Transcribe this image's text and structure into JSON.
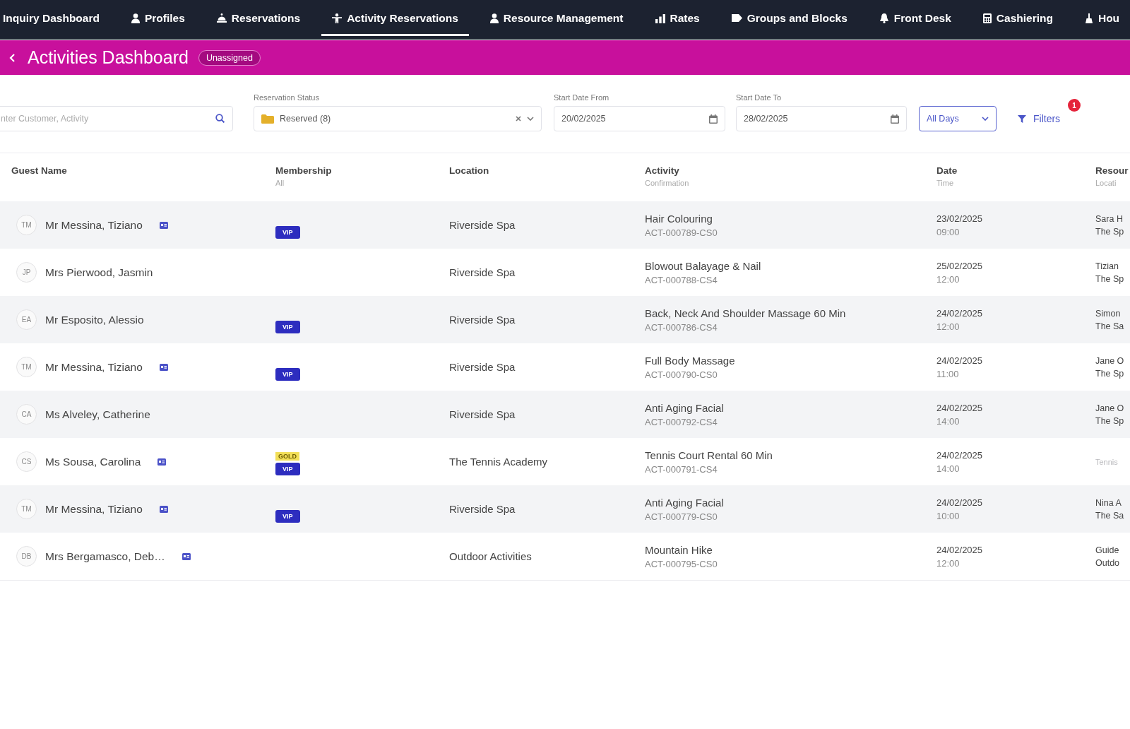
{
  "nav": {
    "items": [
      {
        "label": "Inquiry Dashboard",
        "selected": false
      },
      {
        "label": "Profiles",
        "selected": false
      },
      {
        "label": "Reservations",
        "selected": false
      },
      {
        "label": "Activity Reservations",
        "selected": true
      },
      {
        "label": "Resource Management",
        "selected": false
      },
      {
        "label": "Rates",
        "selected": false
      },
      {
        "label": "Groups and Blocks",
        "selected": false
      },
      {
        "label": "Front Desk",
        "selected": false
      },
      {
        "label": "Cashiering",
        "selected": false
      },
      {
        "label": "Hou",
        "selected": false
      }
    ]
  },
  "header": {
    "title": "Activities Dashboard",
    "badge": "Unassigned"
  },
  "filters": {
    "search": {
      "placeholder": "nter Customer, Activity"
    },
    "status": {
      "label": "Reservation Status",
      "value": "Reserved (8)"
    },
    "date_from": {
      "label": "Start Date From",
      "value": "20/02/2025"
    },
    "date_to": {
      "label": "Start Date To",
      "value": "28/02/2025"
    },
    "days": {
      "value": "All Days"
    },
    "more": {
      "label": "Filters",
      "count": "1"
    }
  },
  "table": {
    "columns": [
      {
        "title": "Guest Name"
      },
      {
        "title": "Membership",
        "subtitle": "All"
      },
      {
        "title": "Location"
      },
      {
        "title": "Activity",
        "subtitle": "Confirmation"
      },
      {
        "title": "Date",
        "subtitle": "Time"
      },
      {
        "title": "Resour",
        "subtitle": "Locati"
      }
    ],
    "rows": [
      {
        "initials": "TM",
        "guest": "Mr Messina, Tiziano",
        "note": true,
        "membership": [
          {
            "kind": "pill",
            "label": "VIP"
          }
        ],
        "location": "Riverside Spa",
        "activity": "Hair Colouring",
        "confirmation": "ACT-000789-CS0",
        "date": "23/02/2025",
        "time": "09:00",
        "resource": [
          "Sara H",
          "The Sp"
        ],
        "resource_muted": false
      },
      {
        "initials": "JP",
        "guest": "Mrs Pierwood, Jasmin",
        "note": false,
        "location": "Riverside Spa",
        "activity": "Blowout Balayage & Nail",
        "confirmation": "ACT-000788-CS4",
        "date": "25/02/2025",
        "time": "12:00",
        "resource": [
          "Tizian",
          "The Sp"
        ],
        "resource_muted": false
      },
      {
        "initials": "EA",
        "guest": "Mr Esposito, Alessio",
        "note": false,
        "membership": [
          {
            "kind": "pill",
            "label": "VIP"
          }
        ],
        "location": "Riverside Spa",
        "activity": "Back, Neck And Shoulder Massage 60 Min",
        "confirmation": "ACT-000786-CS4",
        "date": "24/02/2025",
        "time": "12:00",
        "resource": [
          "Simon",
          "The Sa"
        ],
        "resource_muted": false
      },
      {
        "initials": "TM",
        "guest": "Mr Messina, Tiziano",
        "note": true,
        "membership": [
          {
            "kind": "pill",
            "label": "VIP"
          }
        ],
        "location": "Riverside Spa",
        "activity": "Full Body Massage",
        "confirmation": "ACT-000790-CS0",
        "date": "24/02/2025",
        "time": "11:00",
        "resource": [
          "Jane O",
          "The Sp"
        ],
        "resource_muted": false
      },
      {
        "initials": "CA",
        "guest": "Ms Alveley, Catherine",
        "note": false,
        "location": "Riverside Spa",
        "activity": "Anti Aging Facial",
        "confirmation": "ACT-000792-CS4",
        "date": "24/02/2025",
        "time": "14:00",
        "resource": [
          "Jane O",
          "The Sp"
        ],
        "resource_muted": false
      },
      {
        "initials": "CS",
        "guest": "Ms Sousa, Carolina",
        "note": true,
        "membership": [
          {
            "kind": "tier",
            "label": "GOLD"
          },
          {
            "kind": "pill",
            "label": "VIP"
          }
        ],
        "location": "The Tennis Academy",
        "activity": "Tennis Court Rental 60 Min",
        "confirmation": "ACT-000791-CS4",
        "date": "24/02/2025",
        "time": "14:00",
        "resource": [
          "Tennis"
        ],
        "resource_muted": true
      },
      {
        "initials": "TM",
        "guest": "Mr Messina, Tiziano",
        "note": true,
        "membership": [
          {
            "kind": "pill",
            "label": "VIP"
          }
        ],
        "location": "Riverside Spa",
        "activity": "Anti Aging Facial",
        "confirmation": "ACT-000779-CS0",
        "date": "24/02/2025",
        "time": "10:00",
        "resource": [
          "Nina A",
          "The Sa"
        ],
        "resource_muted": false
      },
      {
        "initials": "DB",
        "guest": "Mrs Bergamasco, Deb…",
        "note": true,
        "location": "Outdoor Activities",
        "activity": "Mountain Hike",
        "confirmation": "ACT-000795-CS0",
        "date": "24/02/2025",
        "time": "12:00",
        "resource": [
          "Guide",
          "Outdo"
        ],
        "resource_muted": false
      }
    ]
  }
}
